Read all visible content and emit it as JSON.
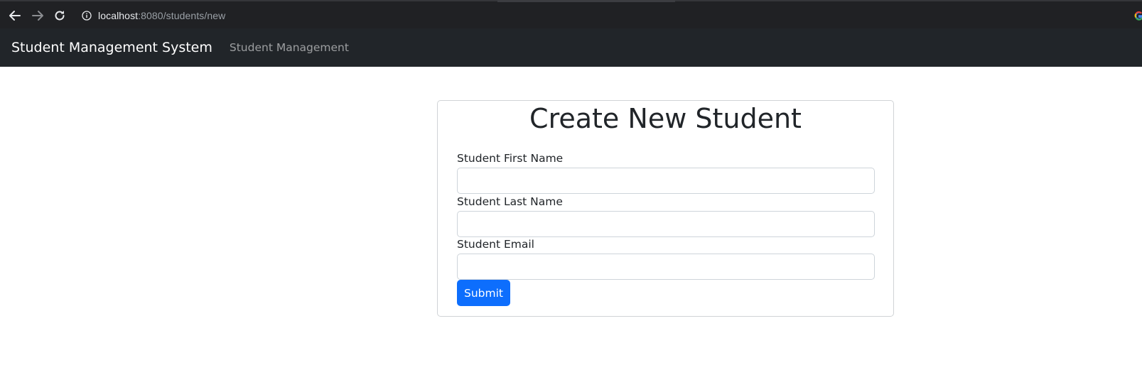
{
  "browser": {
    "url_host": "localhost",
    "url_rest": ":8080/students/new",
    "icons": {
      "back": "arrow-left-icon",
      "forward": "arrow-right-icon",
      "reload": "reload-icon",
      "info": "info-icon",
      "google": "google-icon"
    }
  },
  "navbar": {
    "brand": "Student Management System",
    "links": [
      {
        "label": "Student Management"
      }
    ]
  },
  "form": {
    "title": "Create New Student",
    "fields": [
      {
        "label": "Student First Name",
        "value": "",
        "placeholder": ""
      },
      {
        "label": "Student Last Name",
        "value": "",
        "placeholder": ""
      },
      {
        "label": "Student Email",
        "value": "",
        "placeholder": ""
      }
    ],
    "submit_label": "Submit"
  },
  "colors": {
    "navbar_bg": "#212529",
    "primary": "#0d6efd",
    "browser_bg": "#202124"
  }
}
